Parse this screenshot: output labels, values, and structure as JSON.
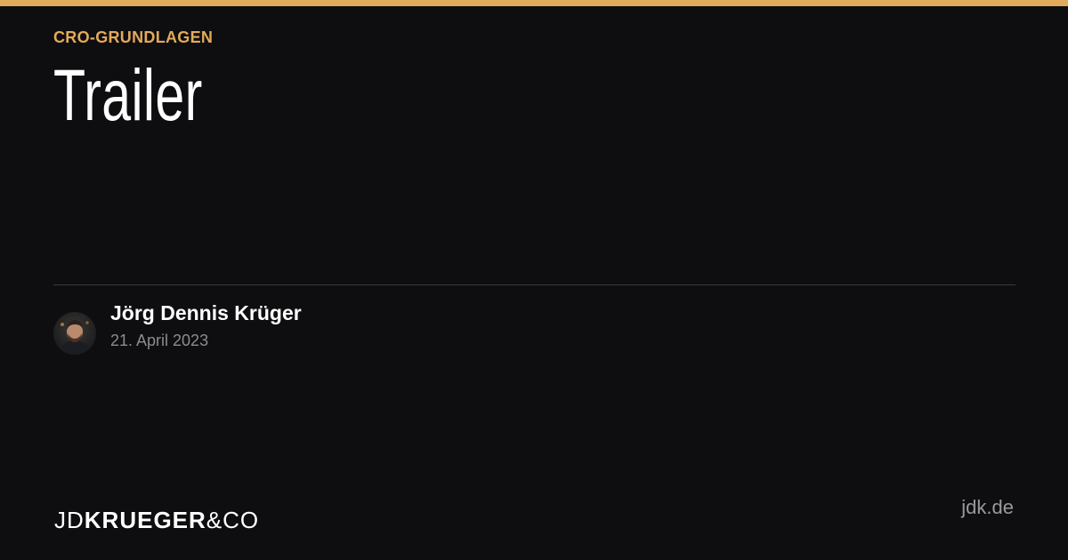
{
  "category": "CRO-GRUNDLAGEN",
  "title": "Trailer",
  "author": {
    "name": "Jörg Dennis Krüger",
    "date": "21. April 2023"
  },
  "logo": {
    "part1": "JD",
    "part2": "KRUEGER",
    "part3": "&CO"
  },
  "domain": "jdk.de",
  "colors": {
    "accent": "#e2aa5a",
    "background": "#0e0e10"
  }
}
